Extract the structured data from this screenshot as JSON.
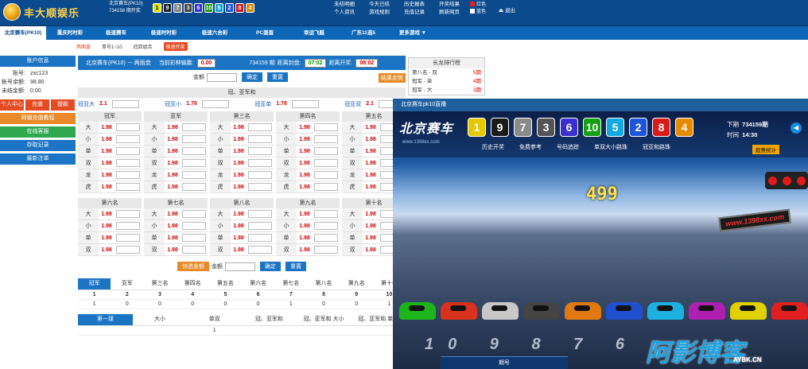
{
  "brand": {
    "name": "丰大顺娱乐"
  },
  "lottery_top": {
    "name": "北京赛车(PK10)",
    "period": "734158",
    "period_label": "期开奖"
  },
  "top_balls": [
    {
      "n": "1",
      "color": "#e6e600",
      "text": "#000"
    },
    {
      "n": "9",
      "color": "#222222",
      "text": "#fff"
    },
    {
      "n": "7",
      "color": "#888888",
      "text": "#fff"
    },
    {
      "n": "3",
      "color": "#444444",
      "text": "#fff"
    },
    {
      "n": "6",
      "color": "#3333cc",
      "text": "#fff"
    },
    {
      "n": "10",
      "color": "#1a9c1a",
      "text": "#fff"
    },
    {
      "n": "5",
      "color": "#1aa3d9",
      "text": "#fff"
    },
    {
      "n": "2",
      "color": "#2256d6",
      "text": "#fff"
    },
    {
      "n": "8",
      "color": "#d61a1a",
      "text": "#fff"
    },
    {
      "n": "4",
      "color": "#e08a00",
      "text": "#fff"
    }
  ],
  "top_menu": [
    "未结明细",
    "今天已结",
    "历史报表",
    "开奖结果",
    "个人资讯",
    "游戏规则",
    "充值记录",
    "刷新网页"
  ],
  "colors_option": {
    "red": "红色",
    "blue": "蓝色"
  },
  "logout": "退出",
  "nav_tabs": [
    "北京赛车(PK10)",
    "重庆时时彩",
    "极速赛车",
    "极速时时彩",
    "极速六合彩",
    "PC蛋蛋",
    "幸运飞艇",
    "广东11选5",
    "更多游戏 ▼"
  ],
  "sub_nav": {
    "items": [
      "两面盘",
      "单号1~10",
      "冠亚组合"
    ],
    "hot": "极速开奖"
  },
  "account": {
    "title": "账户信息",
    "rows": [
      {
        "k": "账号:",
        "v": "zxc123"
      },
      {
        "k": "帐号余额:",
        "v": "98.80"
      },
      {
        "k": "未结金额:",
        "v": "0.00"
      }
    ],
    "btn_center": "个人中心",
    "btn_deposit": "充值",
    "btn_withdraw": "提款",
    "btn_online": "网银充值教程",
    "btn_service": "在线客服",
    "btn_records": "存取记录",
    "btn_latest": "最新注单"
  },
  "info": {
    "lottery": "北京赛车(PK10) － 两面盘",
    "today_label": "当前彩种输赢:",
    "today_val": "0.00",
    "period": "734159 期",
    "close_label": "距离封盘:",
    "close_val": "07:02",
    "open_label": "距离开奖:",
    "open_val": "08:02"
  },
  "amount": {
    "label": "金额",
    "confirm": "确定",
    "reset": "重置",
    "result": "结果走势"
  },
  "champion_section": {
    "title": "冠、亚军和",
    "pairs": [
      {
        "l": "冠亚大",
        "o": "2.1"
      },
      {
        "l": "冠亚小",
        "o": "1.78"
      },
      {
        "l": "冠亚单",
        "o": "1.78"
      },
      {
        "l": "冠亚双",
        "o": "2.1"
      }
    ]
  },
  "ranks1": {
    "names": [
      "冠军",
      "亚军",
      "第三名",
      "第四名",
      "第五名"
    ],
    "rows": [
      "大",
      "小",
      "单",
      "双",
      "龙",
      "虎"
    ],
    "odds": "1.98"
  },
  "ranks2": {
    "names": [
      "第六名",
      "第七名",
      "第八名",
      "第九名",
      "第十名"
    ],
    "rows": [
      "大",
      "小",
      "单",
      "双"
    ],
    "odds": "1.98"
  },
  "bottom_amount": {
    "quick": "快选金额",
    "label": "金额",
    "confirm": "确定",
    "reset": "重置"
  },
  "result_table": {
    "headers": [
      "冠军",
      "亚军",
      "第三名",
      "第四名",
      "第五名",
      "第六名",
      "第七名",
      "第八名",
      "第九名",
      "第十名"
    ],
    "nums": [
      "1",
      "2",
      "3",
      "4",
      "5",
      "6",
      "7",
      "8",
      "9",
      "10"
    ],
    "counts": [
      "1",
      "0",
      "0",
      "0",
      "0",
      "0",
      "1",
      "0",
      "0",
      "1"
    ]
  },
  "stats_tabs": [
    "第一球",
    "大小",
    "单双",
    "冠、亚军和",
    "冠、亚军和 大小",
    "冠、亚军和 单双"
  ],
  "stats_row": [
    "1"
  ],
  "dragon": {
    "title": "长龙排行榜",
    "rows": [
      {
        "k": "第八名 - 双",
        "v": "5期"
      },
      {
        "k": "冠军 - 单",
        "v": "4期"
      },
      {
        "k": "冠军 - 大",
        "v": "3期"
      }
    ]
  },
  "live": {
    "bar_title": "北京赛车pk10直播",
    "title": "北京赛车",
    "site": "www.1398xx.com",
    "balls": [
      {
        "n": "1",
        "color": "#e6c800"
      },
      {
        "n": "9",
        "color": "#1a1a1a"
      },
      {
        "n": "7",
        "color": "#8a8a8a"
      },
      {
        "n": "3",
        "color": "#555555"
      },
      {
        "n": "6",
        "color": "#3b2fcf"
      },
      {
        "n": "10",
        "color": "#14a014"
      },
      {
        "n": "5",
        "color": "#12a8e0"
      },
      {
        "n": "2",
        "color": "#1f55d8"
      },
      {
        "n": "8",
        "color": "#d81c1c"
      },
      {
        "n": "4",
        "color": "#e88a00"
      }
    ],
    "menu": [
      "历史开奖",
      "免费参考",
      "号码追踪",
      "单双大小路珠",
      "冠亚和路珠"
    ],
    "next_label": "下期",
    "next_period": "734159期",
    "time_label": "时间",
    "time_val": "14:30",
    "trend": "趋势统计",
    "counter": "499",
    "board": "www.1398xx.com",
    "car_colors": [
      "#1cb51c",
      "#d8321c",
      "#c8c8c8",
      "#444444",
      "#e07a10",
      "#2050d0",
      "#1cb0e0",
      "#b020b0",
      "#e0d000",
      "#e02020"
    ],
    "track_nums": "10 9 8 7 6",
    "watermark": "阿影博客",
    "watermark_sub": "AYBK.CN",
    "period_label": "期号"
  }
}
